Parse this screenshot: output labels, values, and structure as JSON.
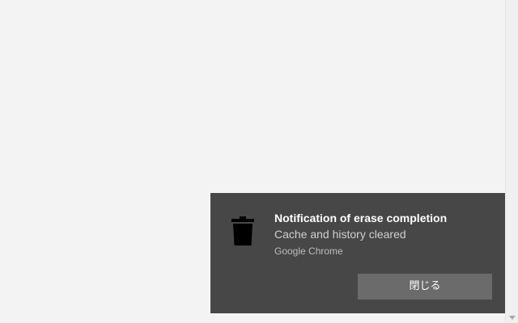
{
  "notification": {
    "title": "Notification of erase completion",
    "body": "Cache and history cleared",
    "app_name": "Google Chrome",
    "icon": "trash-icon",
    "close_button_label": "閉じる"
  },
  "colors": {
    "page_background": "#f3f3f3",
    "toast_background": "#474747",
    "button_background": "#6b6b6b",
    "title_text": "#ffffff",
    "body_text": "#cfcfcf",
    "app_text": "#bdbdbd",
    "icon_color": "#000000"
  }
}
